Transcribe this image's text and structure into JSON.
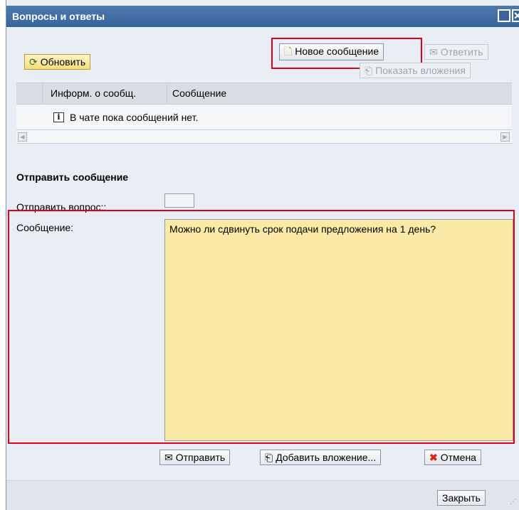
{
  "window": {
    "title": "Вопросы и ответы"
  },
  "toolbar": {
    "refresh_label": "Обновить",
    "new_message_label": "Новое сообщение",
    "reply_label": "Ответить",
    "show_attachments_label": "Показать вложения"
  },
  "table": {
    "columns": [
      "Информ. о сообщ.",
      "Сообщение"
    ],
    "empty_text": "В чате пока сообщений нет."
  },
  "send_section": {
    "title": "Отправить сообщение",
    "question_label": "Отправить вопрос::",
    "message_label": "Сообщение:",
    "message_value": "Можно ли сдвинуть срок подачи предложения на 1 день?",
    "send_label": "Отправить",
    "add_attachment_label": "Добавить вложение...",
    "cancel_label": "Отмена"
  },
  "footer": {
    "close_label": "Закрыть"
  },
  "colors": {
    "highlight": "#e3001b",
    "titlebar": "#3a649a",
    "textarea_bg": "#fbeaa5"
  }
}
